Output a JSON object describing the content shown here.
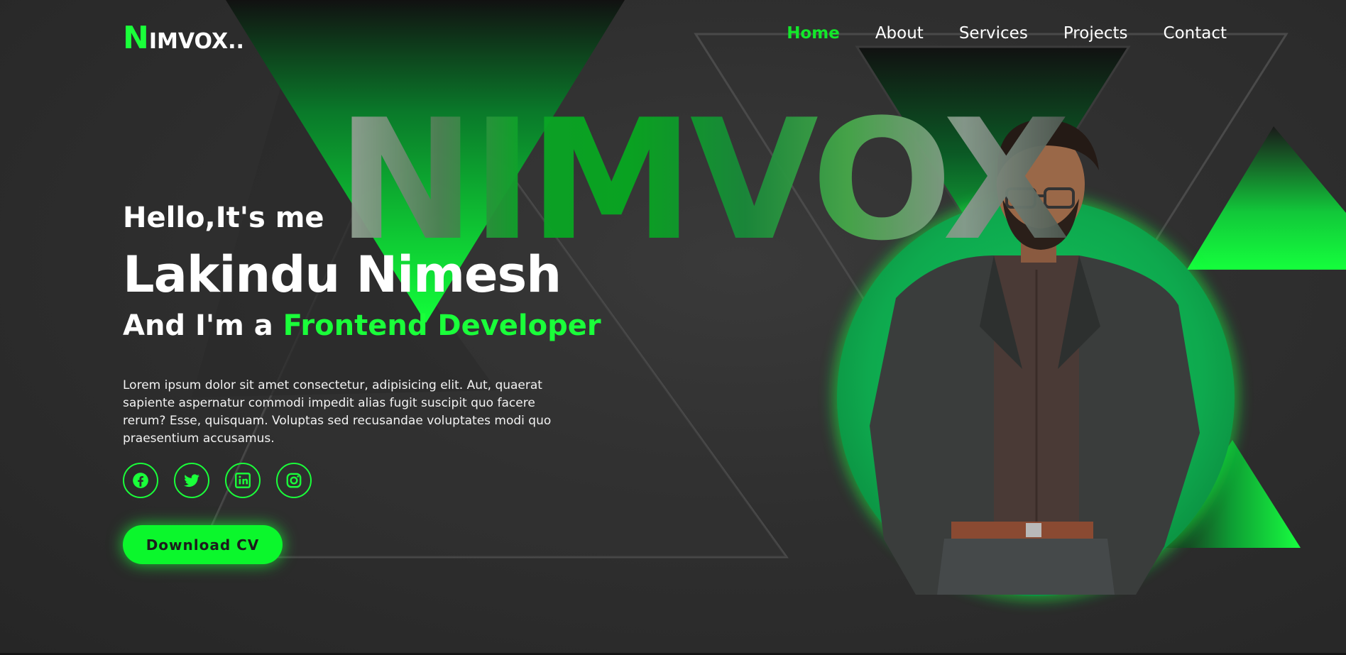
{
  "logo": {
    "first_letter": "N",
    "rest": "IMVOX.."
  },
  "nav": {
    "items": [
      {
        "label": "Home",
        "active": true
      },
      {
        "label": "About",
        "active": false
      },
      {
        "label": "Services",
        "active": false
      },
      {
        "label": "Projects",
        "active": false
      },
      {
        "label": "Contact",
        "active": false
      }
    ]
  },
  "hero": {
    "watermark": "NIMVOX",
    "greeting": "Hello,It's me",
    "name": "Lakindu Nimesh",
    "role_prefix": "And I'm a ",
    "role_highlight": "Frontend Developer",
    "description": "Lorem ipsum dolor sit amet consectetur, adipisicing elit. Aut, quaerat sapiente aspernatur commodi impedit alias fugit suscipit quo facere rerum? Esse, quisquam. Voluptas sed recusandae voluptates modi quo praesentium accusamus.",
    "download_label": "Download CV"
  },
  "socials": [
    {
      "icon": "facebook-icon"
    },
    {
      "icon": "twitter-icon"
    },
    {
      "icon": "linkedin-icon"
    },
    {
      "icon": "instagram-icon"
    }
  ],
  "colors": {
    "accent": "#1aff3a",
    "background": "#2f2f2f",
    "text": "#ffffff"
  },
  "portrait": {
    "alt_description": "man in dark blazer and brown shirt"
  }
}
